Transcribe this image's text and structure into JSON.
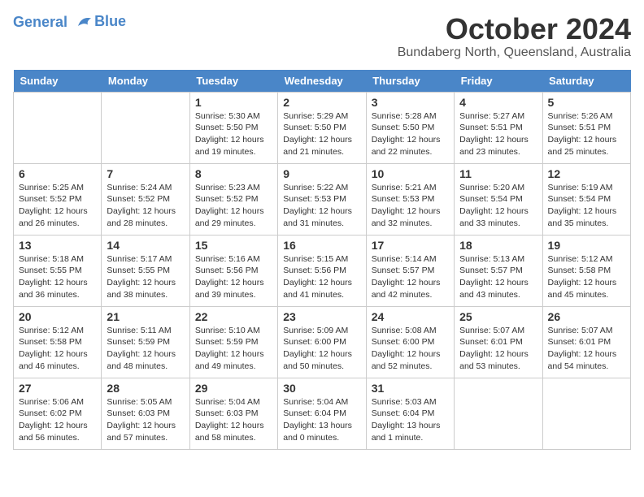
{
  "header": {
    "logo_line1": "General",
    "logo_line2": "Blue",
    "month": "October 2024",
    "location": "Bundaberg North, Queensland, Australia"
  },
  "days_of_week": [
    "Sunday",
    "Monday",
    "Tuesday",
    "Wednesday",
    "Thursday",
    "Friday",
    "Saturday"
  ],
  "weeks": [
    [
      {
        "day": "",
        "empty": true
      },
      {
        "day": "",
        "empty": true
      },
      {
        "day": "1",
        "sunrise": "5:30 AM",
        "sunset": "5:50 PM",
        "daylight": "12 hours and 19 minutes."
      },
      {
        "day": "2",
        "sunrise": "5:29 AM",
        "sunset": "5:50 PM",
        "daylight": "12 hours and 21 minutes."
      },
      {
        "day": "3",
        "sunrise": "5:28 AM",
        "sunset": "5:50 PM",
        "daylight": "12 hours and 22 minutes."
      },
      {
        "day": "4",
        "sunrise": "5:27 AM",
        "sunset": "5:51 PM",
        "daylight": "12 hours and 23 minutes."
      },
      {
        "day": "5",
        "sunrise": "5:26 AM",
        "sunset": "5:51 PM",
        "daylight": "12 hours and 25 minutes."
      }
    ],
    [
      {
        "day": "6",
        "sunrise": "5:25 AM",
        "sunset": "5:52 PM",
        "daylight": "12 hours and 26 minutes."
      },
      {
        "day": "7",
        "sunrise": "5:24 AM",
        "sunset": "5:52 PM",
        "daylight": "12 hours and 28 minutes."
      },
      {
        "day": "8",
        "sunrise": "5:23 AM",
        "sunset": "5:52 PM",
        "daylight": "12 hours and 29 minutes."
      },
      {
        "day": "9",
        "sunrise": "5:22 AM",
        "sunset": "5:53 PM",
        "daylight": "12 hours and 31 minutes."
      },
      {
        "day": "10",
        "sunrise": "5:21 AM",
        "sunset": "5:53 PM",
        "daylight": "12 hours and 32 minutes."
      },
      {
        "day": "11",
        "sunrise": "5:20 AM",
        "sunset": "5:54 PM",
        "daylight": "12 hours and 33 minutes."
      },
      {
        "day": "12",
        "sunrise": "5:19 AM",
        "sunset": "5:54 PM",
        "daylight": "12 hours and 35 minutes."
      }
    ],
    [
      {
        "day": "13",
        "sunrise": "5:18 AM",
        "sunset": "5:55 PM",
        "daylight": "12 hours and 36 minutes."
      },
      {
        "day": "14",
        "sunrise": "5:17 AM",
        "sunset": "5:55 PM",
        "daylight": "12 hours and 38 minutes."
      },
      {
        "day": "15",
        "sunrise": "5:16 AM",
        "sunset": "5:56 PM",
        "daylight": "12 hours and 39 minutes."
      },
      {
        "day": "16",
        "sunrise": "5:15 AM",
        "sunset": "5:56 PM",
        "daylight": "12 hours and 41 minutes."
      },
      {
        "day": "17",
        "sunrise": "5:14 AM",
        "sunset": "5:57 PM",
        "daylight": "12 hours and 42 minutes."
      },
      {
        "day": "18",
        "sunrise": "5:13 AM",
        "sunset": "5:57 PM",
        "daylight": "12 hours and 43 minutes."
      },
      {
        "day": "19",
        "sunrise": "5:12 AM",
        "sunset": "5:58 PM",
        "daylight": "12 hours and 45 minutes."
      }
    ],
    [
      {
        "day": "20",
        "sunrise": "5:12 AM",
        "sunset": "5:58 PM",
        "daylight": "12 hours and 46 minutes."
      },
      {
        "day": "21",
        "sunrise": "5:11 AM",
        "sunset": "5:59 PM",
        "daylight": "12 hours and 48 minutes."
      },
      {
        "day": "22",
        "sunrise": "5:10 AM",
        "sunset": "5:59 PM",
        "daylight": "12 hours and 49 minutes."
      },
      {
        "day": "23",
        "sunrise": "5:09 AM",
        "sunset": "6:00 PM",
        "daylight": "12 hours and 50 minutes."
      },
      {
        "day": "24",
        "sunrise": "5:08 AM",
        "sunset": "6:00 PM",
        "daylight": "12 hours and 52 minutes."
      },
      {
        "day": "25",
        "sunrise": "5:07 AM",
        "sunset": "6:01 PM",
        "daylight": "12 hours and 53 minutes."
      },
      {
        "day": "26",
        "sunrise": "5:07 AM",
        "sunset": "6:01 PM",
        "daylight": "12 hours and 54 minutes."
      }
    ],
    [
      {
        "day": "27",
        "sunrise": "5:06 AM",
        "sunset": "6:02 PM",
        "daylight": "12 hours and 56 minutes."
      },
      {
        "day": "28",
        "sunrise": "5:05 AM",
        "sunset": "6:03 PM",
        "daylight": "12 hours and 57 minutes."
      },
      {
        "day": "29",
        "sunrise": "5:04 AM",
        "sunset": "6:03 PM",
        "daylight": "12 hours and 58 minutes."
      },
      {
        "day": "30",
        "sunrise": "5:04 AM",
        "sunset": "6:04 PM",
        "daylight": "13 hours and 0 minutes."
      },
      {
        "day": "31",
        "sunrise": "5:03 AM",
        "sunset": "6:04 PM",
        "daylight": "13 hours and 1 minute."
      },
      {
        "day": "",
        "empty": true
      },
      {
        "day": "",
        "empty": true
      }
    ]
  ],
  "labels": {
    "sunrise": "Sunrise:",
    "sunset": "Sunset:",
    "daylight": "Daylight:"
  }
}
